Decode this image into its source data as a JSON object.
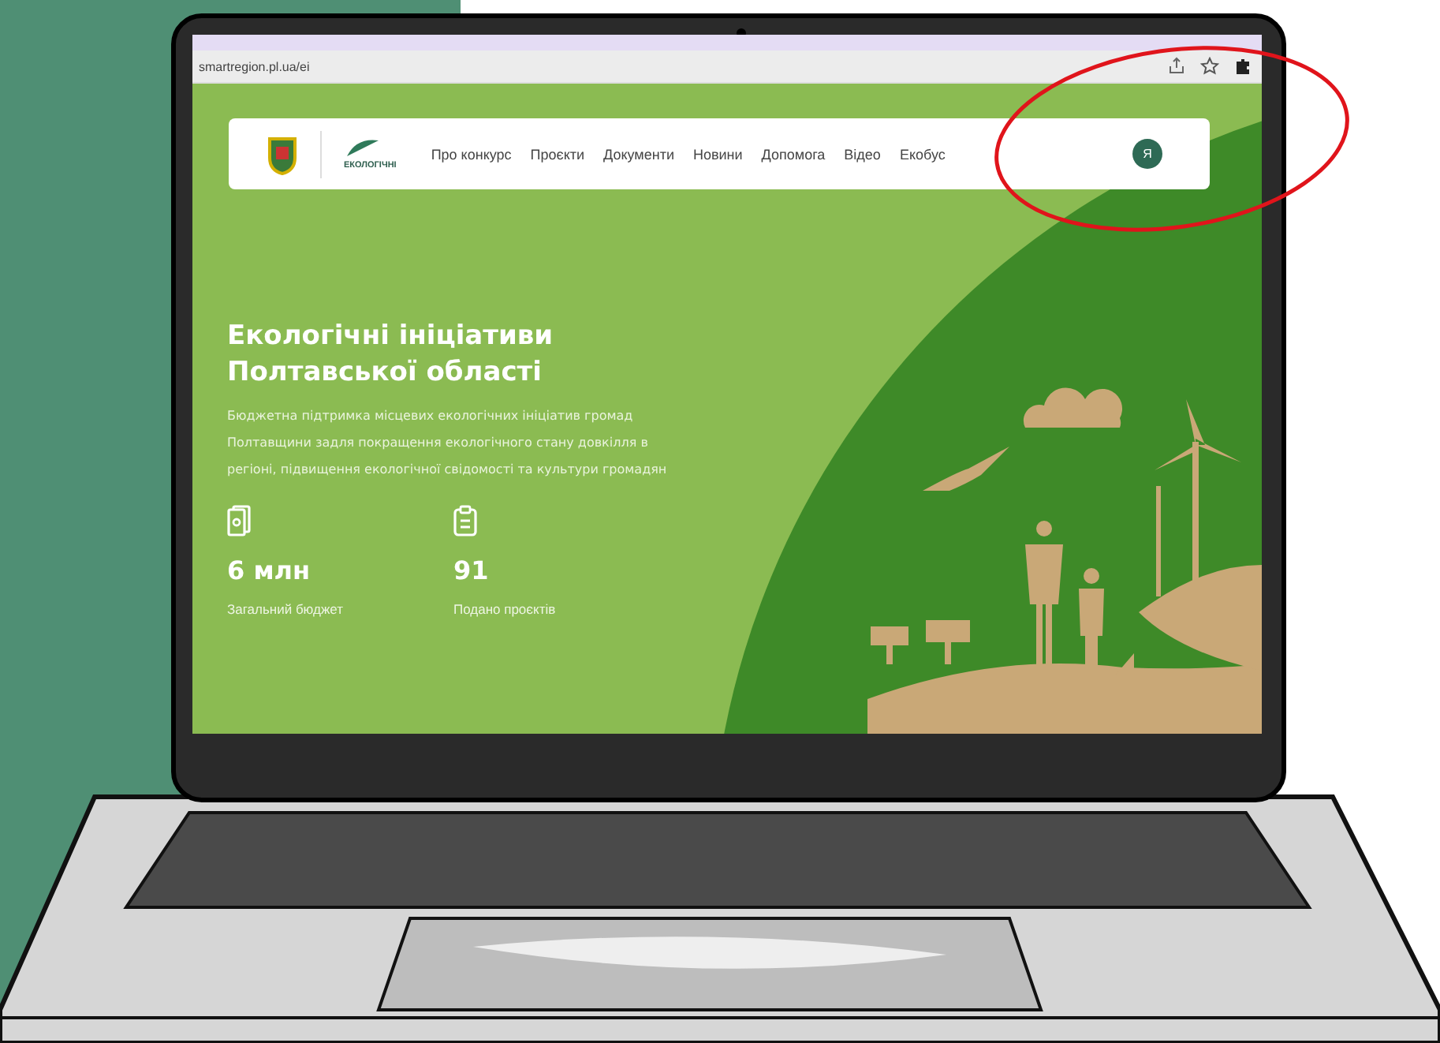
{
  "browser": {
    "url": "smartregion.pl.ua/ei"
  },
  "header": {
    "logo_text": "ЕКОЛОГІЧНІ",
    "nav": [
      {
        "label": "Про конкурс"
      },
      {
        "label": "Проєкти"
      },
      {
        "label": "Документи"
      },
      {
        "label": "Новини"
      },
      {
        "label": "Допомога"
      },
      {
        "label": "Відео"
      },
      {
        "label": "Екобус"
      }
    ],
    "avatar_letter": "Я"
  },
  "hero": {
    "title_lines": [
      "Екологічні ініціативи",
      "Полтавської області"
    ],
    "description": "Бюджетна підтримка місцевих екологічних ініціатив громад Полтавщини задля покращення екологічного стану довкілля в регіоні, підвищення екологічної свідомості та культури громадян",
    "stats": [
      {
        "kind": "money",
        "value": "6 млн",
        "label": "Загальний бюджет"
      },
      {
        "kind": "clipboard",
        "value": "91",
        "label": "Подано проєктів"
      }
    ]
  }
}
